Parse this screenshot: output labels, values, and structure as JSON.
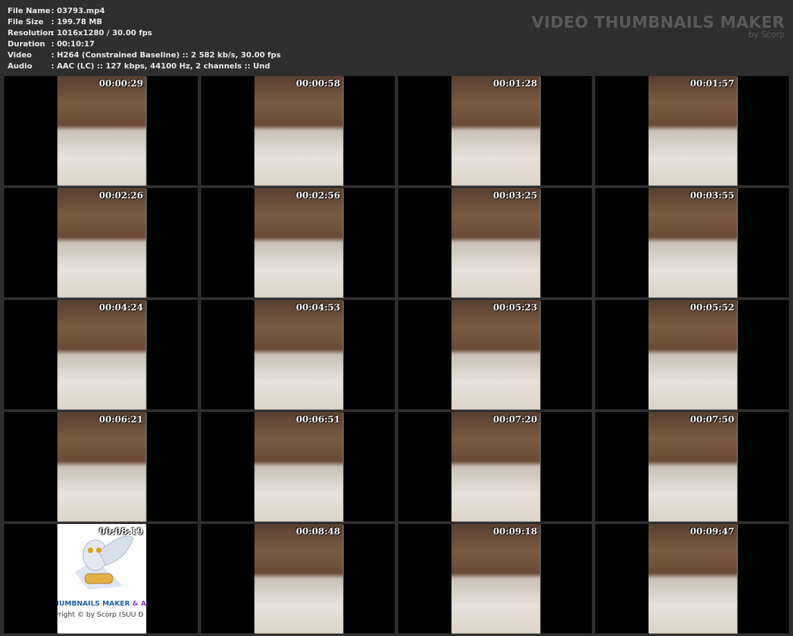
{
  "info": [
    {
      "label": "File Name",
      "value": ": 03793.mp4"
    },
    {
      "label": "File Size",
      "value": ": 199.78 MB"
    },
    {
      "label": "Resolution",
      "value": ": 1016x1280 / 30.00 fps"
    },
    {
      "label": "Duration",
      "value": ": 00:10:17"
    },
    {
      "label": "Video",
      "value": ": H264 (Constrained Baseline) :: 2 582 kb/s, 30.00 fps"
    },
    {
      "label": "Audio",
      "value": ": AAC (LC) :: 127 kbps, 44100 Hz, 2 channels :: Und"
    }
  ],
  "brand": {
    "title": "VIDEO THUMBNAILS MAKER",
    "subtitle": "by Scorp"
  },
  "timestamps": [
    "00:00:29",
    "00:00:58",
    "00:01:28",
    "00:01:57",
    "00:02:26",
    "00:02:56",
    "00:03:25",
    "00:03:55",
    "00:04:24",
    "00:04:53",
    "00:05:23",
    "00:05:52",
    "00:06:21",
    "00:06:51",
    "00:07:20",
    "00:07:50",
    "00:08:19",
    "00:08:48",
    "00:09:18",
    "00:09:47"
  ],
  "logo": {
    "line1": "HUMBNAILS MAKER",
    "line1b": " & AN",
    "line2": "yright © by Scorp (SUU D"
  }
}
